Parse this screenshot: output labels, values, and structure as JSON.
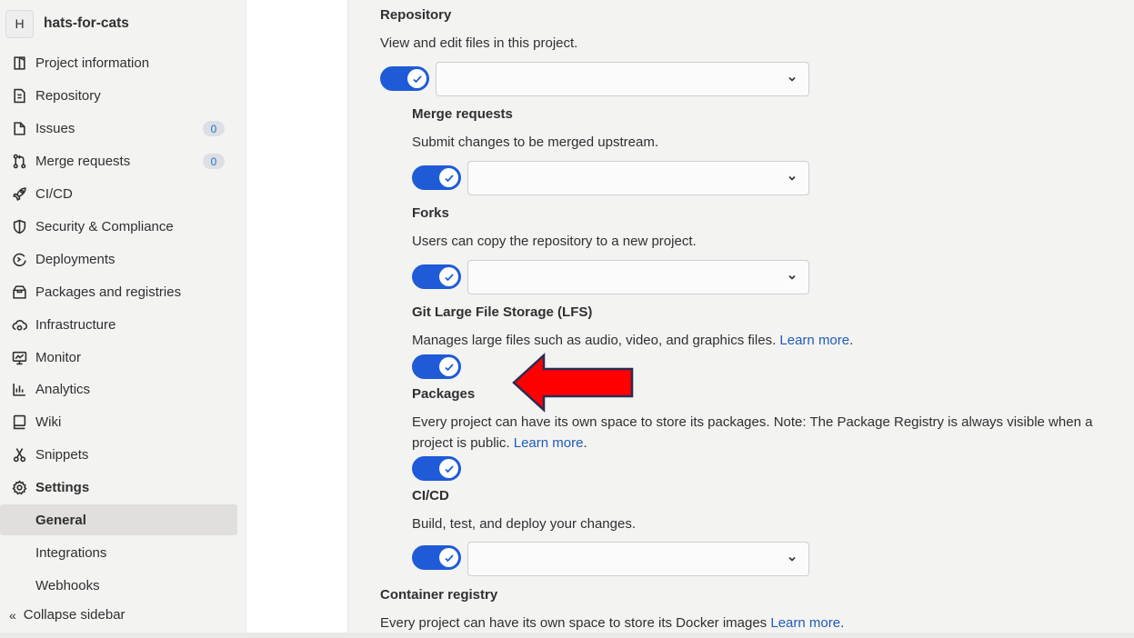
{
  "sidebar": {
    "avatar": "H",
    "project_name": "hats-for-cats",
    "items": [
      {
        "label": "Project information",
        "icon": "project-icon"
      },
      {
        "label": "Repository",
        "icon": "document-icon"
      },
      {
        "label": "Issues",
        "icon": "issues-icon",
        "badge": "0"
      },
      {
        "label": "Merge requests",
        "icon": "merge-request-icon",
        "badge": "0"
      },
      {
        "label": "CI/CD",
        "icon": "rocket-icon"
      },
      {
        "label": "Security & Compliance",
        "icon": "shield-icon"
      },
      {
        "label": "Deployments",
        "icon": "deployments-icon"
      },
      {
        "label": "Packages and registries",
        "icon": "package-icon"
      },
      {
        "label": "Infrastructure",
        "icon": "cloud-gear-icon"
      },
      {
        "label": "Monitor",
        "icon": "monitor-icon"
      },
      {
        "label": "Analytics",
        "icon": "chart-icon"
      },
      {
        "label": "Wiki",
        "icon": "book-icon"
      },
      {
        "label": "Snippets",
        "icon": "scissors-icon"
      },
      {
        "label": "Settings",
        "icon": "gear-icon"
      }
    ],
    "sub_items": [
      {
        "label": "General",
        "active": true
      },
      {
        "label": "Integrations",
        "active": false
      },
      {
        "label": "Webhooks",
        "active": false
      }
    ],
    "collapse_label": "Collapse sidebar"
  },
  "settings": {
    "repository": {
      "title": "Repository",
      "desc": "View and edit files in this project.",
      "enabled": true,
      "select_value": ""
    },
    "merge_requests": {
      "title": "Merge requests",
      "desc": "Submit changes to be merged upstream.",
      "enabled": true,
      "select_value": ""
    },
    "forks": {
      "title": "Forks",
      "desc": "Users can copy the repository to a new project.",
      "enabled": true,
      "select_value": ""
    },
    "lfs": {
      "title": "Git Large File Storage (LFS)",
      "desc": "Manages large files such as audio, video, and graphics files.",
      "link": "Learn more",
      "trail": ".",
      "enabled": true
    },
    "packages": {
      "title": "Packages",
      "desc_line1": "Every project can have its own space to store its packages. Note: The Package Registry is always visible when a",
      "desc_line2": "project is public.",
      "link": "Learn more",
      "trail": ".",
      "enabled": true
    },
    "cicd": {
      "title": "CI/CD",
      "desc": "Build, test, and deploy your changes.",
      "enabled": true,
      "select_value": ""
    },
    "container_registry": {
      "title": "Container registry",
      "desc": "Every project can have its own space to store its Docker images",
      "link": "Learn more",
      "trail": "."
    }
  },
  "colors": {
    "toggle_on": "#1f5bd7",
    "link": "#1f5bb8",
    "arrow": "#ff0000"
  }
}
